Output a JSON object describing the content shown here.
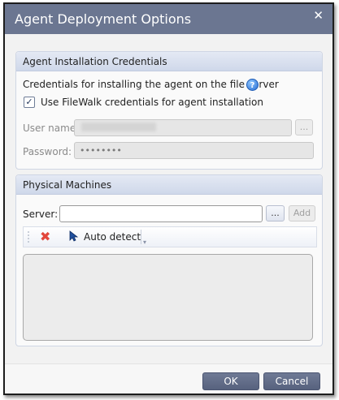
{
  "dialog": {
    "title": "Agent Deployment Options",
    "close_glyph": "✕"
  },
  "credentials": {
    "header": "Agent Installation Credentials",
    "description": "Credentials for installing the agent on the file server",
    "help_icon": "help-icon",
    "use_filewalk_label": "Use FileWalk credentials for agent installation",
    "use_filewalk_checked": true,
    "username_label": "User name:",
    "username_value": "",
    "username_browse": "...",
    "password_label": "Password:",
    "password_value": "••••••••"
  },
  "physical": {
    "header": "Physical Machines",
    "server_label": "Server:",
    "server_value": "",
    "browse_label": "...",
    "add_label": "Add",
    "toolbar": {
      "delete_icon": "delete-x-icon",
      "auto_detect_label": "Auto detect",
      "auto_detect_icon": "auto-detect-cursor-icon"
    },
    "machines": []
  },
  "footer": {
    "ok_label": "OK",
    "cancel_label": "Cancel"
  },
  "colors": {
    "titlebar": "#6b7691",
    "button": "#5d6884",
    "group_header": "#d6ddee"
  }
}
